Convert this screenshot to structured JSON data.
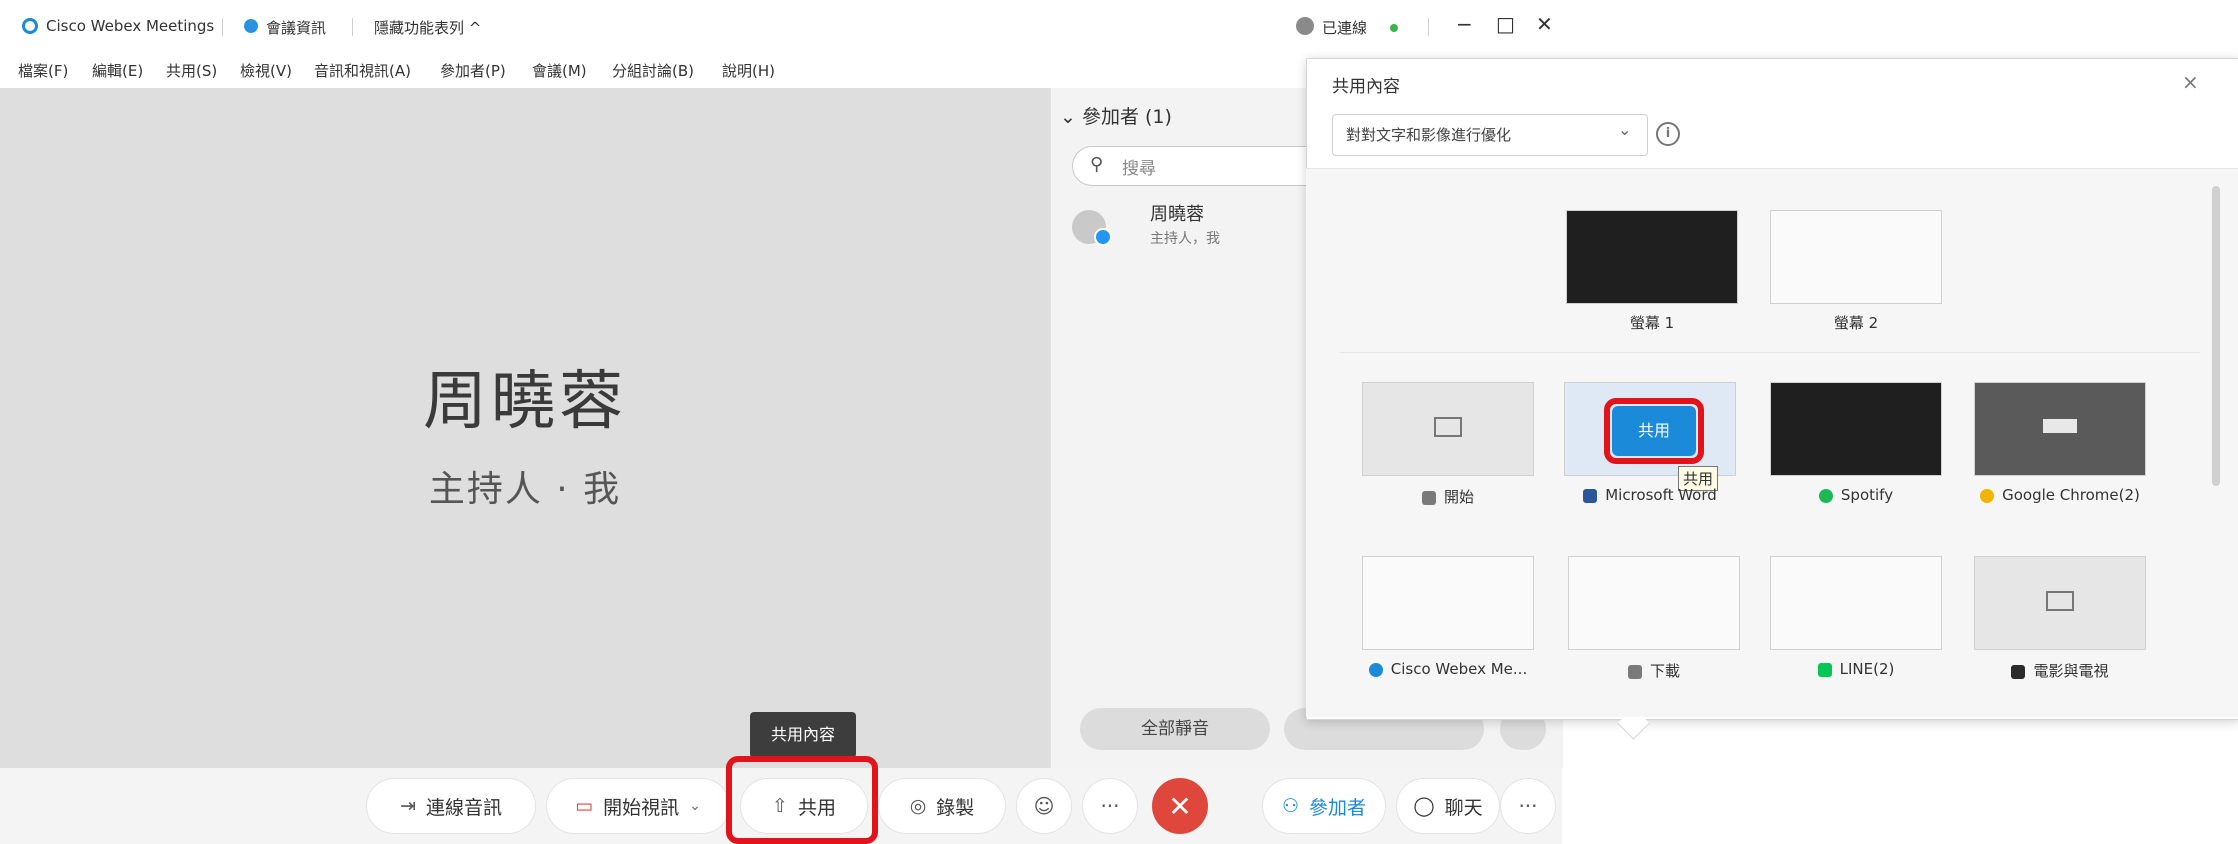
{
  "titlebar": {
    "app_title": "Cisco Webex Meetings",
    "meeting_info": "會議資訊",
    "hide_menu": "隱藏功能表列",
    "hide_menu_chevron": "^",
    "connected": "已連線",
    "minimize": "−",
    "maximize": "□",
    "close": "✕"
  },
  "menubar": [
    "檔案(F)",
    "編輯(E)",
    "共用(S)",
    "檢視(V)",
    "音訊和視訊(A)",
    "參加者(P)",
    "會議(M)",
    "分組討論(B)",
    "說明(H)"
  ],
  "stage": {
    "name": "周曉蓉",
    "role": "主持人 · 我",
    "tooltip": "共用內容"
  },
  "participants_panel": {
    "header": "參加者 (1)",
    "search_placeholder": "搜尋",
    "participant_name": "周曉蓉",
    "participant_role": "主持人，我",
    "mute_all": "全部靜音"
  },
  "controlbar": {
    "connect_audio": "連線音訊",
    "start_video": "開始視訊",
    "share": "共用",
    "record": "錄製",
    "more": "···",
    "end": "✕",
    "participants": "參加者",
    "chat": "聊天",
    "panel_more": "···"
  },
  "share_dialog": {
    "title": "共用內容",
    "close": "×",
    "optimize": "對對文字和影像進行優化",
    "info": "i",
    "screens": [
      "螢幕 1",
      "螢幕 2"
    ],
    "apps_row1": [
      "開始",
      "Microsoft Word",
      "Spotify",
      "Google Chrome(2)"
    ],
    "apps_row2": [
      "Cisco Webex Me...",
      "下載",
      "LINE(2)",
      "電影與電視"
    ],
    "share_button": "共用",
    "share_tooltip": "共用"
  },
  "colors": {
    "accent_blue": "#1a8ad9",
    "end_red": "#e0473c",
    "highlight_red": "#e0141a",
    "connected_green": "#3bb54a"
  }
}
